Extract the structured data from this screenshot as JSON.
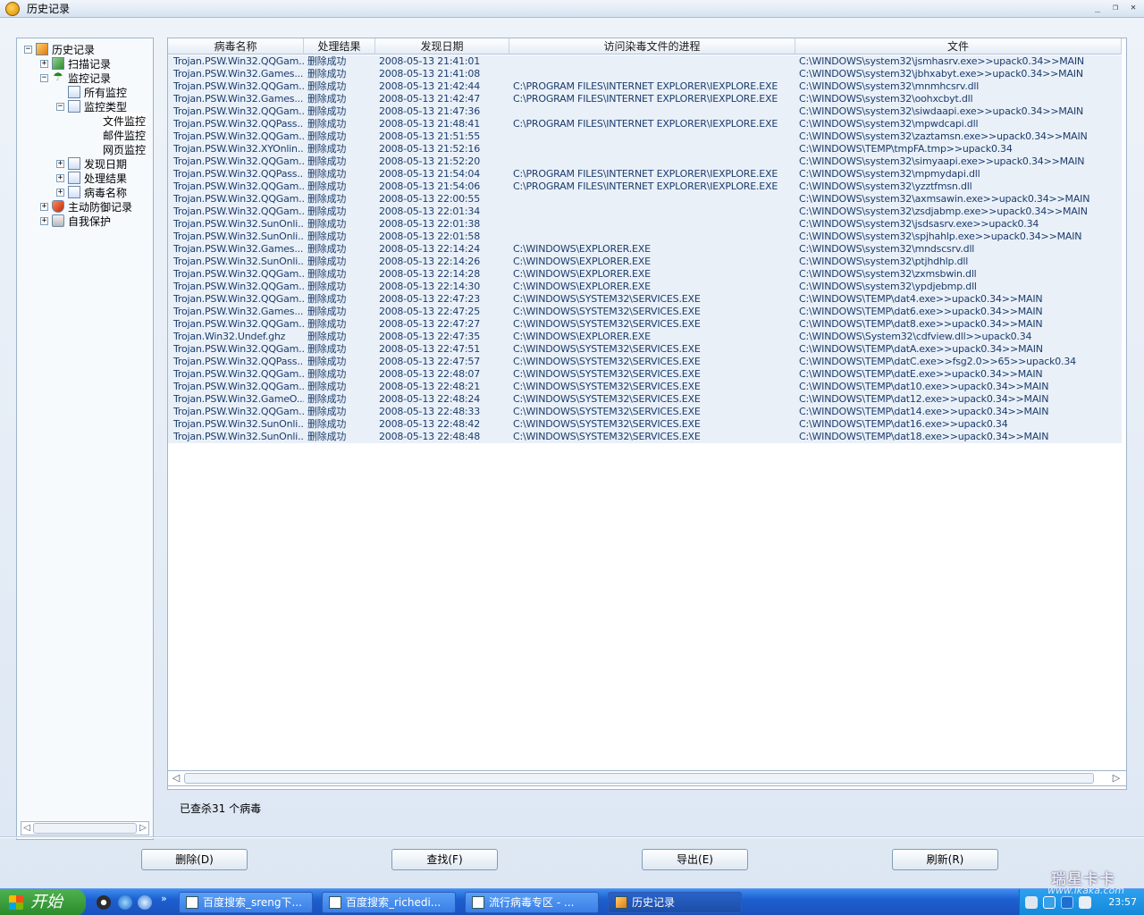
{
  "window": {
    "title": "历史记录",
    "btn_min": "_",
    "btn_restore": "❐",
    "btn_close": "✕"
  },
  "tree": {
    "items": [
      {
        "label": "历史记录",
        "expander": "−"
      },
      {
        "label": "扫描记录",
        "expander": "+"
      },
      {
        "label": "监控记录",
        "expander": "−"
      },
      {
        "label": "所有监控"
      },
      {
        "label": "监控类型",
        "expander": "−"
      },
      {
        "label": "文件监控"
      },
      {
        "label": "邮件监控"
      },
      {
        "label": "网页监控"
      },
      {
        "label": "发现日期",
        "expander": "+"
      },
      {
        "label": "处理结果",
        "expander": "+"
      },
      {
        "label": "病毒名称",
        "expander": "+"
      },
      {
        "label": "主动防御记录",
        "expander": "+"
      },
      {
        "label": "自我保护",
        "expander": "+"
      }
    ]
  },
  "grid": {
    "columns": [
      "病毒名称",
      "处理结果",
      "发现日期",
      "访问染毒文件的进程",
      "文件"
    ],
    "rows": [
      [
        "Trojan.PSW.Win32.QQGam...",
        "删除成功",
        "2008-05-13 21:41:01",
        "",
        "C:\\WINDOWS\\system32\\jsmhasrv.exe>>upack0.34>>MAIN"
      ],
      [
        "Trojan.PSW.Win32.Games...",
        "删除成功",
        "2008-05-13 21:41:08",
        "",
        "C:\\WINDOWS\\system32\\jbhxabyt.exe>>upack0.34>>MAIN"
      ],
      [
        "Trojan.PSW.Win32.QQGam...",
        "删除成功",
        "2008-05-13 21:42:44",
        "C:\\PROGRAM FILES\\INTERNET EXPLORER\\IEXPLORE.EXE",
        "C:\\WINDOWS\\system32\\mnmhcsrv.dll"
      ],
      [
        "Trojan.PSW.Win32.Games...",
        "删除成功",
        "2008-05-13 21:42:47",
        "C:\\PROGRAM FILES\\INTERNET EXPLORER\\IEXPLORE.EXE",
        "C:\\WINDOWS\\system32\\oohxcbyt.dll"
      ],
      [
        "Trojan.PSW.Win32.QQGam...",
        "删除成功",
        "2008-05-13 21:47:36",
        "",
        "C:\\WINDOWS\\system32\\siwdaapi.exe>>upack0.34>>MAIN"
      ],
      [
        "Trojan.PSW.Win32.QQPass...",
        "删除成功",
        "2008-05-13 21:48:41",
        "C:\\PROGRAM FILES\\INTERNET EXPLORER\\IEXPLORE.EXE",
        "C:\\WINDOWS\\system32\\mpwdcapi.dll"
      ],
      [
        "Trojan.PSW.Win32.QQGam...",
        "删除成功",
        "2008-05-13 21:51:55",
        "",
        "C:\\WINDOWS\\system32\\zaztamsn.exe>>upack0.34>>MAIN"
      ],
      [
        "Trojan.PSW.Win32.XYOnlin...",
        "删除成功",
        "2008-05-13 21:52:16",
        "",
        "C:\\WINDOWS\\TEMP\\tmpFA.tmp>>upack0.34"
      ],
      [
        "Trojan.PSW.Win32.QQGam...",
        "删除成功",
        "2008-05-13 21:52:20",
        "",
        "C:\\WINDOWS\\system32\\simyaapi.exe>>upack0.34>>MAIN"
      ],
      [
        "Trojan.PSW.Win32.QQPass...",
        "删除成功",
        "2008-05-13 21:54:04",
        "C:\\PROGRAM FILES\\INTERNET EXPLORER\\IEXPLORE.EXE",
        "C:\\WINDOWS\\system32\\mpmydapi.dll"
      ],
      [
        "Trojan.PSW.Win32.QQGam...",
        "删除成功",
        "2008-05-13 21:54:06",
        "C:\\PROGRAM FILES\\INTERNET EXPLORER\\IEXPLORE.EXE",
        "C:\\WINDOWS\\system32\\yzztfmsn.dll"
      ],
      [
        "Trojan.PSW.Win32.QQGam...",
        "删除成功",
        "2008-05-13 22:00:55",
        "",
        "C:\\WINDOWS\\system32\\axmsawin.exe>>upack0.34>>MAIN"
      ],
      [
        "Trojan.PSW.Win32.QQGam...",
        "删除成功",
        "2008-05-13 22:01:34",
        "",
        "C:\\WINDOWS\\system32\\zsdjabmp.exe>>upack0.34>>MAIN"
      ],
      [
        "Trojan.PSW.Win32.SunOnli...",
        "删除成功",
        "2008-05-13 22:01:38",
        "",
        "C:\\WINDOWS\\system32\\jsdsasrv.exe>>upack0.34"
      ],
      [
        "Trojan.PSW.Win32.SunOnli...",
        "删除成功",
        "2008-05-13 22:01:58",
        "",
        "C:\\WINDOWS\\system32\\spjhahlp.exe>>upack0.34>>MAIN"
      ],
      [
        "Trojan.PSW.Win32.Games...",
        "删除成功",
        "2008-05-13 22:14:24",
        "C:\\WINDOWS\\EXPLORER.EXE",
        "C:\\WINDOWS\\system32\\mndscsrv.dll"
      ],
      [
        "Trojan.PSW.Win32.SunOnli...",
        "删除成功",
        "2008-05-13 22:14:26",
        "C:\\WINDOWS\\EXPLORER.EXE",
        "C:\\WINDOWS\\system32\\ptjhdhlp.dll"
      ],
      [
        "Trojan.PSW.Win32.QQGam...",
        "删除成功",
        "2008-05-13 22:14:28",
        "C:\\WINDOWS\\EXPLORER.EXE",
        "C:\\WINDOWS\\system32\\zxmsbwin.dll"
      ],
      [
        "Trojan.PSW.Win32.QQGam...",
        "删除成功",
        "2008-05-13 22:14:30",
        "C:\\WINDOWS\\EXPLORER.EXE",
        "C:\\WINDOWS\\system32\\ypdjebmp.dll"
      ],
      [
        "Trojan.PSW.Win32.QQGam...",
        "删除成功",
        "2008-05-13 22:47:23",
        "C:\\WINDOWS\\SYSTEM32\\SERVICES.EXE",
        "C:\\WINDOWS\\TEMP\\dat4.exe>>upack0.34>>MAIN"
      ],
      [
        "Trojan.PSW.Win32.Games...",
        "删除成功",
        "2008-05-13 22:47:25",
        "C:\\WINDOWS\\SYSTEM32\\SERVICES.EXE",
        "C:\\WINDOWS\\TEMP\\dat6.exe>>upack0.34>>MAIN"
      ],
      [
        "Trojan.PSW.Win32.QQGam...",
        "删除成功",
        "2008-05-13 22:47:27",
        "C:\\WINDOWS\\SYSTEM32\\SERVICES.EXE",
        "C:\\WINDOWS\\TEMP\\dat8.exe>>upack0.34>>MAIN"
      ],
      [
        "Trojan.Win32.Undef.ghz",
        "删除成功",
        "2008-05-13 22:47:35",
        "C:\\WINDOWS\\EXPLORER.EXE",
        "C:\\WINDOWS\\System32\\cdfview.dll>>upack0.34"
      ],
      [
        "Trojan.PSW.Win32.QQGam...",
        "删除成功",
        "2008-05-13 22:47:51",
        "C:\\WINDOWS\\SYSTEM32\\SERVICES.EXE",
        "C:\\WINDOWS\\TEMP\\datA.exe>>upack0.34>>MAIN"
      ],
      [
        "Trojan.PSW.Win32.QQPass...",
        "删除成功",
        "2008-05-13 22:47:57",
        "C:\\WINDOWS\\SYSTEM32\\SERVICES.EXE",
        "C:\\WINDOWS\\TEMP\\datC.exe>>fsg2.0>>65>>upack0.34"
      ],
      [
        "Trojan.PSW.Win32.QQGam...",
        "删除成功",
        "2008-05-13 22:48:07",
        "C:\\WINDOWS\\SYSTEM32\\SERVICES.EXE",
        "C:\\WINDOWS\\TEMP\\datE.exe>>upack0.34>>MAIN"
      ],
      [
        "Trojan.PSW.Win32.QQGam...",
        "删除成功",
        "2008-05-13 22:48:21",
        "C:\\WINDOWS\\SYSTEM32\\SERVICES.EXE",
        "C:\\WINDOWS\\TEMP\\dat10.exe>>upack0.34>>MAIN"
      ],
      [
        "Trojan.PSW.Win32.GameO...",
        "删除成功",
        "2008-05-13 22:48:24",
        "C:\\WINDOWS\\SYSTEM32\\SERVICES.EXE",
        "C:\\WINDOWS\\TEMP\\dat12.exe>>upack0.34>>MAIN"
      ],
      [
        "Trojan.PSW.Win32.QQGam...",
        "删除成功",
        "2008-05-13 22:48:33",
        "C:\\WINDOWS\\SYSTEM32\\SERVICES.EXE",
        "C:\\WINDOWS\\TEMP\\dat14.exe>>upack0.34>>MAIN"
      ],
      [
        "Trojan.PSW.Win32.SunOnli...",
        "删除成功",
        "2008-05-13 22:48:42",
        "C:\\WINDOWS\\SYSTEM32\\SERVICES.EXE",
        "C:\\WINDOWS\\TEMP\\dat16.exe>>upack0.34"
      ],
      [
        "Trojan.PSW.Win32.SunOnli...",
        "删除成功",
        "2008-05-13 22:48:48",
        "C:\\WINDOWS\\SYSTEM32\\SERVICES.EXE",
        "C:\\WINDOWS\\TEMP\\dat18.exe>>upack0.34>>MAIN"
      ]
    ]
  },
  "status": {
    "text": "已查杀31 个病毒"
  },
  "buttons": {
    "delete": "删除(D)",
    "find": "查找(F)",
    "export": "导出(E)",
    "refresh": "刷新(R)"
  },
  "taskbar": {
    "start_label": "开始",
    "more": "»",
    "tasks": [
      "百度搜索_sreng下...",
      "百度搜索_richedi...",
      "流行病毒专区 - ...",
      "历史记录"
    ],
    "clock": "23:57"
  },
  "watermark": {
    "text": "瑞星卡卡",
    "url": "www.ikaka.com"
  },
  "colors": {
    "grid_row_bg": "#e9f0f8",
    "grid_text": "#1c3c6c",
    "taskbar": "#1d5fd0"
  }
}
